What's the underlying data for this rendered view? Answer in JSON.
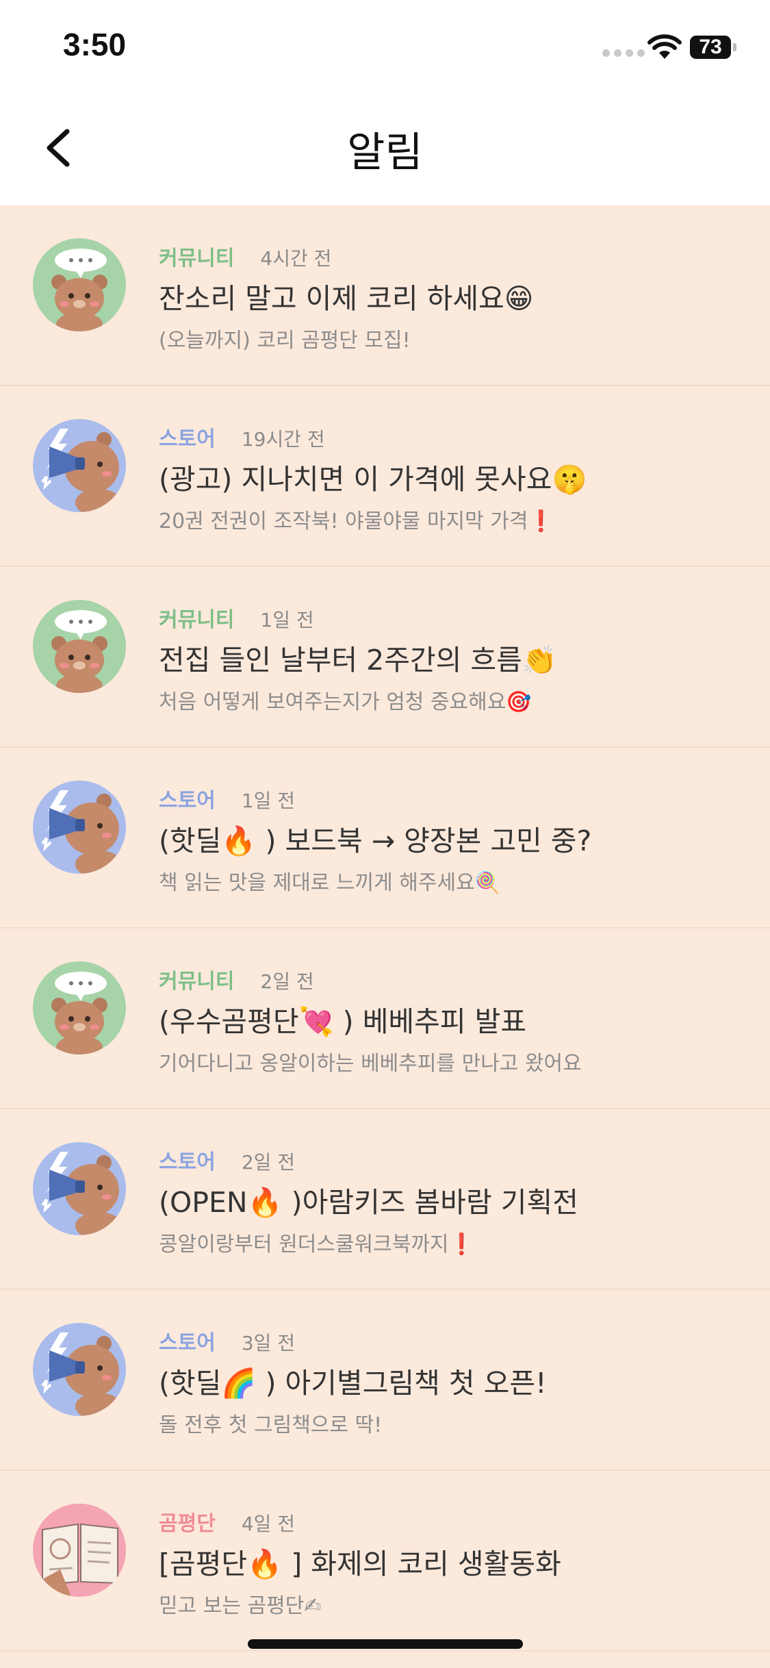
{
  "status_bar": {
    "time": "3:50",
    "battery": "73"
  },
  "header": {
    "title": "알림"
  },
  "colors": {
    "background": "#fbe9dc",
    "community": "#7dbf86",
    "store": "#8aa3e0",
    "reviewer": "#f08c94"
  },
  "notifications": [
    {
      "category": "커뮤니티",
      "category_type": "community",
      "avatar_icon": "bear-speech-bubble-icon",
      "time": "4시간 전",
      "title": "잔소리 말고 이제 코리 하세요😁",
      "subtitle": "(오늘까지) 코리 곰평단 모집!"
    },
    {
      "category": "스토어",
      "category_type": "store",
      "avatar_icon": "bear-megaphone-icon",
      "time": "19시간 전",
      "title": "(광고) 지나치면 이 가격에 못사요🤫",
      "subtitle": "20권 전권이 조작북! 야물야물 마지막 가격❗"
    },
    {
      "category": "커뮤니티",
      "category_type": "community",
      "avatar_icon": "bear-speech-bubble-icon",
      "time": "1일 전",
      "title": "전집 들인 날부터 2주간의 흐름👏",
      "subtitle": "처음 어떻게 보여주는지가 엄청 중요해요🎯"
    },
    {
      "category": "스토어",
      "category_type": "store",
      "avatar_icon": "bear-megaphone-icon",
      "time": "1일 전",
      "title": "(핫딜🔥 ) 보드북 → 양장본 고민 중?",
      "subtitle": "책 읽는 맛을 제대로 느끼게 해주세요🍭"
    },
    {
      "category": "커뮤니티",
      "category_type": "community",
      "avatar_icon": "bear-speech-bubble-icon",
      "time": "2일 전",
      "title": "(우수곰평단💘 ) 베베추피 발표",
      "subtitle": "기어다니고 옹알이하는 베베추피를 만나고 왔어요"
    },
    {
      "category": "스토어",
      "category_type": "store",
      "avatar_icon": "bear-megaphone-icon",
      "time": "2일 전",
      "title": "(OPEN🔥 )아람키즈 봄바람 기획전",
      "subtitle": "콩알이랑부터 원더스쿨워크북까지❗"
    },
    {
      "category": "스토어",
      "category_type": "store",
      "avatar_icon": "bear-megaphone-icon",
      "time": "3일 전",
      "title": "(핫딜🌈 ) 아기별그림책 첫 오픈!",
      "subtitle": "돌 전후 첫 그림책으로 딱!"
    },
    {
      "category": "곰평단",
      "category_type": "reviewer",
      "avatar_icon": "open-book-icon",
      "time": "4일 전",
      "title": "[곰평단🔥 ] 화제의 코리 생활동화",
      "subtitle": "믿고 보는 곰평단✍"
    }
  ]
}
